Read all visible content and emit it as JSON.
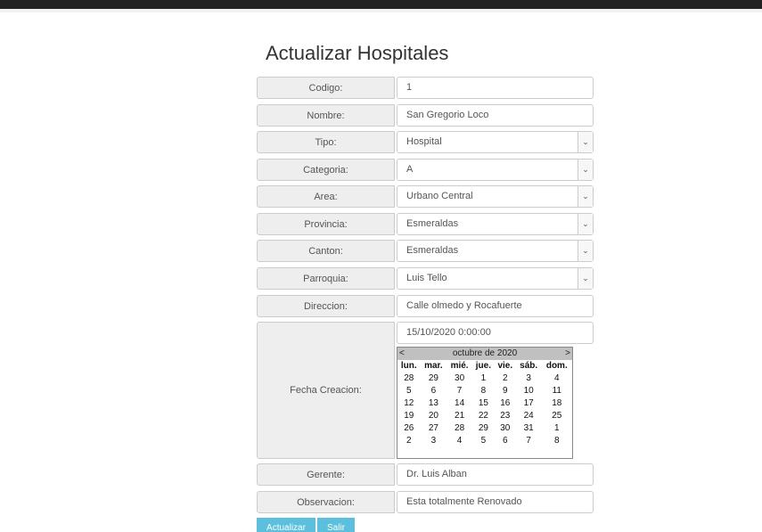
{
  "page": {
    "title": "Actualizar Hospitales"
  },
  "form": {
    "codigo": {
      "label": "Codigo:",
      "value": "1"
    },
    "nombre": {
      "label": "Nombre:",
      "value": "San Gregorio Loco"
    },
    "tipo": {
      "label": "Tipo:",
      "value": "Hospital"
    },
    "categoria": {
      "label": "Categoria:",
      "value": "A"
    },
    "area": {
      "label": "Area:",
      "value": "Urbano Central"
    },
    "provincia": {
      "label": "Provincia:",
      "value": "Esmeraldas"
    },
    "canton": {
      "label": "Canton:",
      "value": "Esmeraldas"
    },
    "parroquia": {
      "label": "Parroquia:",
      "value": "Luis Tello"
    },
    "direccion": {
      "label": "Direccion:",
      "value": "Calle olmedo y Rocafuerte"
    },
    "fecha": {
      "label": "Fecha Creacion:",
      "value": "15/10/2020 0:00:00"
    },
    "gerente": {
      "label": "Gerente:",
      "value": "Dr. Luis Alban"
    },
    "observacion": {
      "label": "Observacion:",
      "value": "Esta totalmente Renovado"
    }
  },
  "calendar": {
    "prev": "<",
    "next": ">",
    "month_label": "octubre de 2020",
    "weekdays": [
      "lun.",
      "mar.",
      "mié.",
      "jue.",
      "vie.",
      "sáb.",
      "dom."
    ],
    "weeks": [
      [
        "28",
        "29",
        "30",
        "1",
        "2",
        "3",
        "4"
      ],
      [
        "5",
        "6",
        "7",
        "8",
        "9",
        "10",
        "11"
      ],
      [
        "12",
        "13",
        "14",
        "15",
        "16",
        "17",
        "18"
      ],
      [
        "19",
        "20",
        "21",
        "22",
        "23",
        "24",
        "25"
      ],
      [
        "26",
        "27",
        "28",
        "29",
        "30",
        "31",
        "1"
      ],
      [
        "2",
        "3",
        "4",
        "5",
        "6",
        "7",
        "8"
      ]
    ]
  },
  "buttons": {
    "actualizar": "Actualizar",
    "salir": "Salir"
  },
  "icons": {
    "select_arrow": "chevron-down-icon"
  }
}
